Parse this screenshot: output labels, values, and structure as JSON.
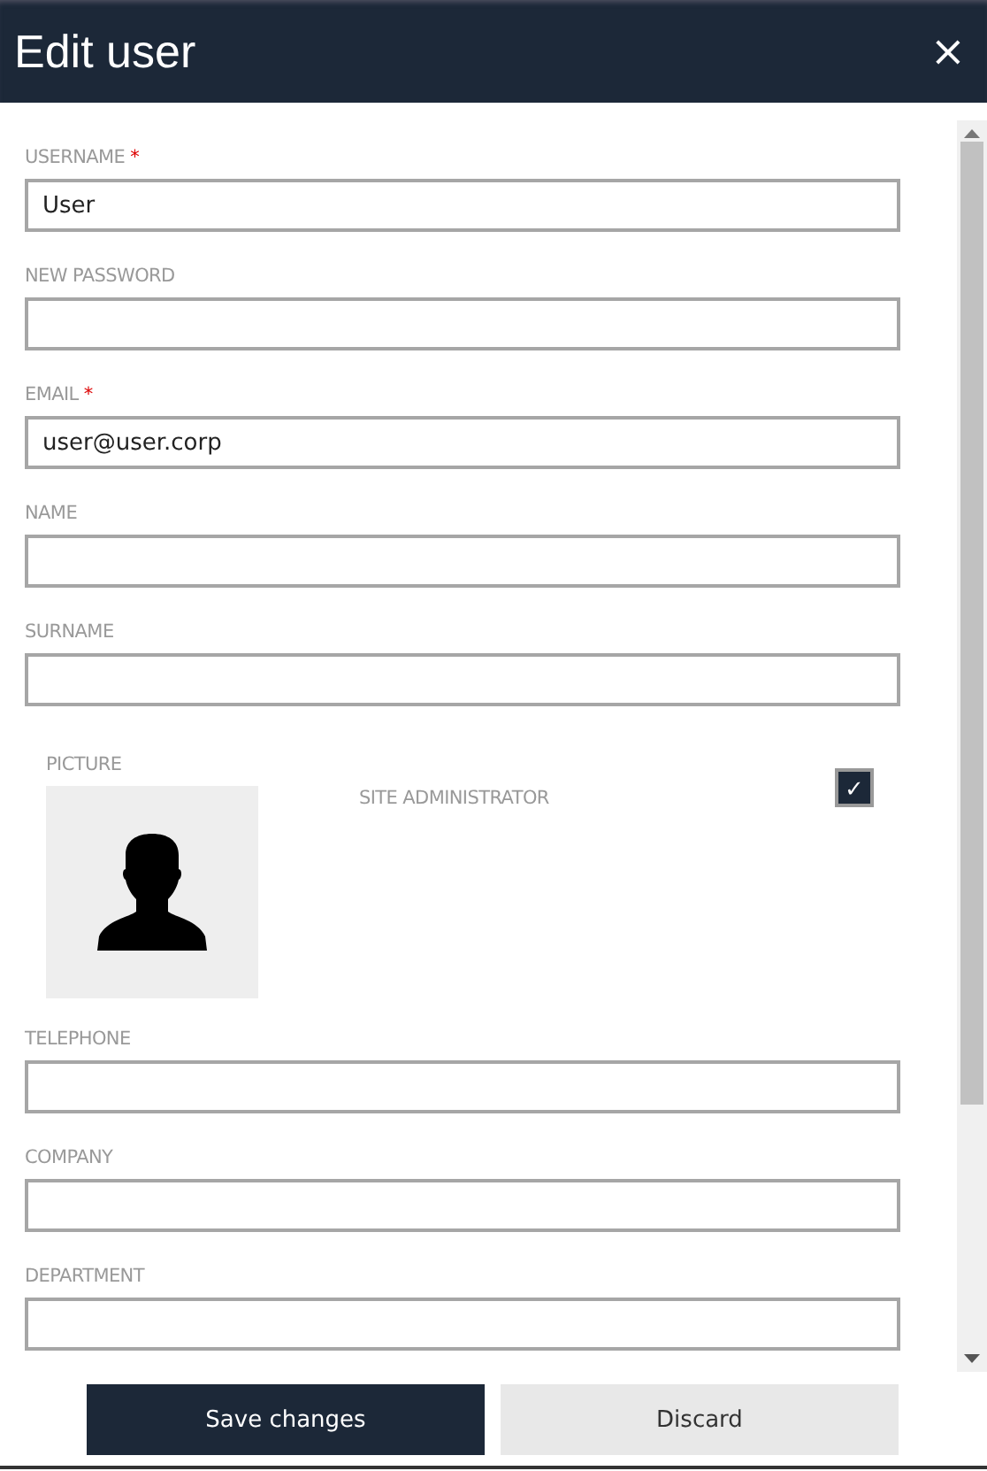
{
  "window": {
    "title": "Edit user",
    "close": "×"
  },
  "fields_top": [
    {
      "label": "USERNAME",
      "required_mark": "*",
      "value": "User"
    },
    {
      "label": "NEW PASSWORD"
    },
    {
      "label": "EMAIL",
      "required_mark": "*",
      "value": "user@user.corp"
    },
    {
      "label": "NAME"
    },
    {
      "label": "SURNAME"
    }
  ],
  "picture": {
    "label": "PICTURE"
  },
  "site_administrator": {
    "label": "SITE ADMINISTRATOR",
    "checked": true,
    "mark": "✓"
  },
  "fields_bottom": [
    {
      "label": "TELEPHONE"
    },
    {
      "label": "COMPANY"
    },
    {
      "label": "DEPARTMENT"
    }
  ],
  "buttons": [
    {
      "label": "Save changes",
      "kind": "primary"
    },
    {
      "label": "Discard",
      "kind": "secondary"
    }
  ]
}
